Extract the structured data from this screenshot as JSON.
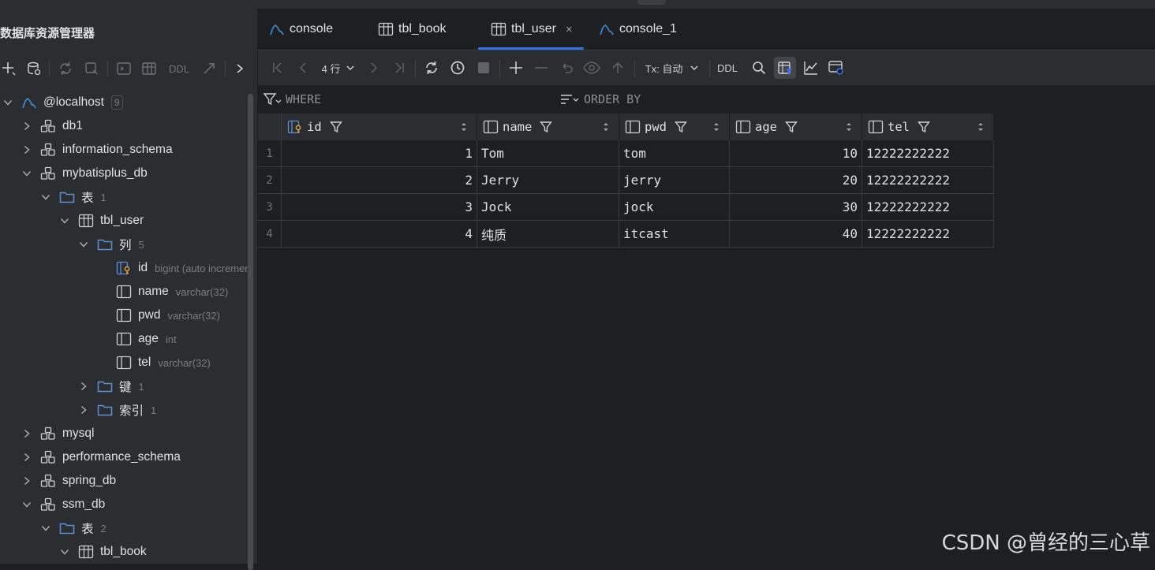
{
  "panel": {
    "title": "数据库资源管理器",
    "toolbar": {
      "ddl": "DDL"
    }
  },
  "tree": [
    {
      "label": "@localhost",
      "count": "9",
      "depth": 0,
      "icon": "mysql-icon",
      "expanded": true
    },
    {
      "label": "db1",
      "depth": 1,
      "icon": "schema-icon",
      "expanded": false
    },
    {
      "label": "information_schema",
      "depth": 1,
      "icon": "schema-icon",
      "expanded": false
    },
    {
      "label": "mybatisplus_db",
      "depth": 1,
      "icon": "schema-icon",
      "expanded": true
    },
    {
      "label": "表",
      "sub": "1",
      "depth": 2,
      "icon": "folder-icon",
      "expanded": true
    },
    {
      "label": "tbl_user",
      "depth": 3,
      "icon": "table-icon",
      "expanded": true
    },
    {
      "label": "列",
      "sub": "5",
      "depth": 4,
      "icon": "folder-icon",
      "expanded": true
    },
    {
      "label": "id",
      "sub": "bigint (auto increment)",
      "depth": 5,
      "icon": "key-column-icon",
      "leaf": true
    },
    {
      "label": "name",
      "sub": "varchar(32)",
      "depth": 5,
      "icon": "column-icon",
      "leaf": true
    },
    {
      "label": "pwd",
      "sub": "varchar(32)",
      "depth": 5,
      "icon": "column-icon",
      "leaf": true
    },
    {
      "label": "age",
      "sub": "int",
      "depth": 5,
      "icon": "column-icon",
      "leaf": true
    },
    {
      "label": "tel",
      "sub": "varchar(32)",
      "depth": 5,
      "icon": "column-icon",
      "leaf": true
    },
    {
      "label": "键",
      "sub": "1",
      "depth": 4,
      "icon": "folder-icon",
      "expanded": false
    },
    {
      "label": "索引",
      "sub": "1",
      "depth": 4,
      "icon": "folder-icon",
      "expanded": false
    },
    {
      "label": "mysql",
      "depth": 1,
      "icon": "schema-icon",
      "expanded": false
    },
    {
      "label": "performance_schema",
      "depth": 1,
      "icon": "schema-icon",
      "expanded": false
    },
    {
      "label": "spring_db",
      "depth": 1,
      "icon": "schema-icon",
      "expanded": false
    },
    {
      "label": "ssm_db",
      "depth": 1,
      "icon": "schema-icon",
      "expanded": true
    },
    {
      "label": "表",
      "sub": "2",
      "depth": 2,
      "icon": "folder-icon",
      "expanded": true
    },
    {
      "label": "tbl_book",
      "depth": 3,
      "icon": "table-icon",
      "expanded": true
    }
  ],
  "tabs": [
    {
      "label": "console",
      "icon": "console-icon",
      "active": false
    },
    {
      "label": "tbl_book",
      "icon": "table-icon",
      "active": false
    },
    {
      "label": "tbl_user",
      "icon": "table-icon",
      "active": true,
      "close": "×"
    },
    {
      "label": "console_1",
      "icon": "console-icon",
      "active": false
    }
  ],
  "grid_toolbar": {
    "rows_label": "4 行",
    "tx_label": "Tx: 自动",
    "ddl_label": "DDL"
  },
  "filter": {
    "where": "WHERE",
    "order_by": "ORDER BY"
  },
  "table": {
    "columns": [
      {
        "name": "id",
        "key": true
      },
      {
        "name": "name"
      },
      {
        "name": "pwd"
      },
      {
        "name": "age"
      },
      {
        "name": "tel"
      }
    ],
    "rows": [
      {
        "n": "1",
        "id": "1",
        "name": "Tom",
        "pwd": "tom",
        "age": "10",
        "tel": "12222222222"
      },
      {
        "n": "2",
        "id": "2",
        "name": "Jerry",
        "pwd": "jerry",
        "age": "20",
        "tel": "12222222222"
      },
      {
        "n": "3",
        "id": "3",
        "name": "Jock",
        "pwd": "jock",
        "age": "30",
        "tel": "12222222222"
      },
      {
        "n": "4",
        "id": "4",
        "name": "纯质",
        "pwd": "itcast",
        "age": "40",
        "tel": "12222222222"
      }
    ]
  },
  "watermark": "CSDN @曾经的三心草",
  "colors": {
    "accent": "#3574f0",
    "folder": "#5c8fd6",
    "mysql": "#3d8fd6"
  }
}
